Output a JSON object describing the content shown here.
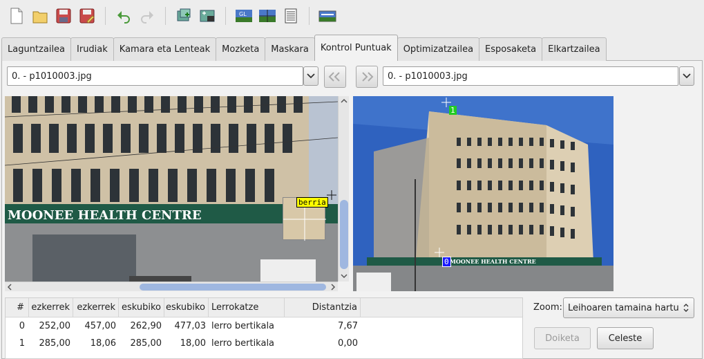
{
  "toolbar": {
    "icons": [
      "new-file-icon",
      "open-folder-icon",
      "save-icon",
      "save-as-icon",
      "undo-icon",
      "redo-icon",
      "add-image-icon",
      "add-control-points-icon",
      "opengl-preview-icon",
      "preview-icon",
      "table-icon",
      "panorama-icon"
    ]
  },
  "tabs": [
    {
      "label": "Laguntzailea"
    },
    {
      "label": "Irudiak"
    },
    {
      "label": "Kamara eta Lenteak"
    },
    {
      "label": "Mozketa"
    },
    {
      "label": "Maskara"
    },
    {
      "label": "Kontrol Puntuak"
    },
    {
      "label": "Optimizatzailea"
    },
    {
      "label": "Esposaketa"
    },
    {
      "label": "Elkartzailea"
    }
  ],
  "left_image": {
    "selected": "0. - p1010003.jpg",
    "marker_label": "berria"
  },
  "right_image": {
    "selected": "0. - p1010003.jpg",
    "marker_0": "0",
    "marker_1": "1"
  },
  "table": {
    "headers": [
      "#",
      "ezkerrek",
      "ezkerrek",
      "eskubiko",
      "eskubiko",
      "Lerrokatze",
      "Distantzia"
    ],
    "rows": [
      [
        "0",
        "252,00",
        "457,00",
        "262,90",
        "477,03",
        "lerro bertikala",
        "7,67"
      ],
      [
        "1",
        "285,00",
        "18,06",
        "285,00",
        "18,00",
        "lerro bertikala",
        "0,00"
      ]
    ]
  },
  "zoom": {
    "label": "Zoom:",
    "value": "Leihoaren tamaina hartu"
  },
  "buttons": {
    "delete": "Doiketa",
    "fine_tune": "Celeste"
  },
  "colors": {
    "accent": "#9fb7e0",
    "marker_new": "#ffff00",
    "marker_0": "#1a1aff",
    "marker_1": "#22cc22"
  }
}
